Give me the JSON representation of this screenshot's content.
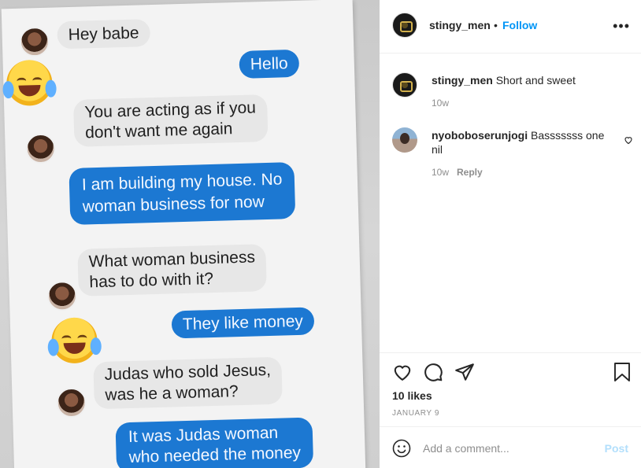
{
  "photo": {
    "messages": [
      {
        "dir": "in",
        "text": "Hey babe"
      },
      {
        "dir": "out",
        "text": "Hello"
      },
      {
        "dir": "in",
        "text": "You are acting as if you",
        "text2": "don't want me again"
      },
      {
        "dir": "out",
        "text": "I am building my house. No",
        "text2": "woman business for now"
      },
      {
        "dir": "in",
        "text": "What woman business",
        "text2": "has to do with it?"
      },
      {
        "dir": "out",
        "text": "They like money"
      },
      {
        "dir": "in",
        "text": "Judas who sold Jesus,",
        "text2": "was he a woman?"
      },
      {
        "dir": "out",
        "text": "It was Judas woman",
        "text2": "who needed the money"
      }
    ],
    "emoji_name": "face-with-tears-of-joy-icon"
  },
  "header": {
    "username": "stingy_men",
    "separator": "•",
    "follow_label": "Follow",
    "more_icon": "more-options-icon",
    "more_glyph": "•••"
  },
  "comments": [
    {
      "username": "stingy_men",
      "text": "Short and sweet",
      "age": "10w"
    },
    {
      "username": "nyoboboserunjogi",
      "text": "Basssssss one nil",
      "age": "10w",
      "reply_label": "Reply"
    }
  ],
  "actions": {
    "icons": [
      "heart-icon",
      "comment-icon",
      "share-icon",
      "bookmark-icon"
    ],
    "likes": "10 likes",
    "date": "JANUARY 9"
  },
  "add_comment": {
    "placeholder": "Add a comment...",
    "post_label": "Post",
    "emoji_icon": "smiley-icon"
  },
  "colors": {
    "accent": "#0095f6",
    "bubble_out": "#1c78d2",
    "bubble_in": "#e7e7e7",
    "post_disabled": "#b2dffc"
  }
}
